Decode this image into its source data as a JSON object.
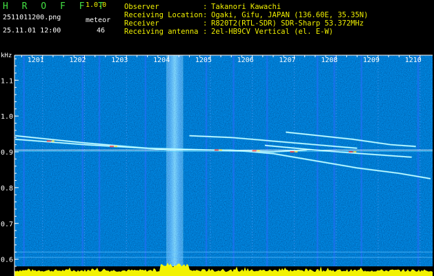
{
  "header": {
    "app_title": "H R O F F T",
    "app_version": "1.0.0",
    "filename": "2511011200.png",
    "meteor_label": "meteor",
    "datetime": "25.11.01 12:00",
    "meteor_count": "46"
  },
  "info": [
    {
      "label": "Observer",
      "value": "Takanori Kawachi"
    },
    {
      "label": "Receiving Location",
      "value": "Ogaki, Gifu, JAPAN (136.60E, 35.35N)"
    },
    {
      "label": "Receiver",
      "value": "R820T2(RTL-SDR) SDR-Sharp 53.372MHz"
    },
    {
      "label": "Receiving antenna",
      "value": "2el-HB9CV Vertical (el. E-W)"
    }
  ],
  "info_separator": ":",
  "chart_data": {
    "type": "heatmap",
    "ylabel": "kHz",
    "x_ticks": [
      "1201",
      "1202",
      "1203",
      "1204",
      "1205",
      "1206",
      "1207",
      "1208",
      "1209",
      "1210"
    ],
    "y_ticks": [
      "1.1",
      "1.0",
      "0.9",
      "0.8",
      "0.7",
      "0.6"
    ],
    "x_range": [
      1200.33,
      1210.3
    ],
    "y_range": [
      0.58,
      1.17
    ],
    "carrier_line_khz": 0.905,
    "marker_lines_khz": [
      0.62,
      0.605
    ],
    "traces": [
      {
        "points": [
          [
            1200.35,
            0.945
          ],
          [
            1202.0,
            0.925
          ],
          [
            1203.0,
            0.915
          ],
          [
            1204.0,
            0.905
          ],
          [
            1205.5,
            0.905
          ],
          [
            1206.5,
            0.895
          ],
          [
            1207.5,
            0.875
          ],
          [
            1208.5,
            0.855
          ],
          [
            1209.5,
            0.84
          ],
          [
            1210.25,
            0.825
          ]
        ]
      },
      {
        "points": [
          [
            1200.35,
            0.935
          ],
          [
            1202.0,
            0.92
          ],
          [
            1203.5,
            0.91
          ],
          [
            1205.0,
            0.905
          ],
          [
            1206.5,
            0.9
          ],
          [
            1207.3,
            0.905
          ]
        ]
      },
      {
        "points": [
          [
            1204.5,
            0.945
          ],
          [
            1205.5,
            0.94
          ],
          [
            1206.5,
            0.93
          ],
          [
            1207.5,
            0.92
          ],
          [
            1208.5,
            0.91
          ]
        ]
      },
      {
        "points": [
          [
            1206.8,
            0.955
          ],
          [
            1207.6,
            0.945
          ],
          [
            1208.4,
            0.935
          ],
          [
            1209.3,
            0.92
          ],
          [
            1209.9,
            0.915
          ]
        ]
      },
      {
        "points": [
          [
            1206.3,
            0.918
          ],
          [
            1207.5,
            0.905
          ],
          [
            1208.6,
            0.895
          ],
          [
            1209.8,
            0.885
          ]
        ]
      }
    ],
    "noise_band_x": [
      1203.95,
      1204.35
    ],
    "colors": {
      "background": "#000033",
      "carrier": "#ffffff",
      "axis": "#ffffff",
      "tick_label": "#ffffff",
      "marker_line": "#60c0ff",
      "bottom_signal": "#ffff00"
    }
  }
}
